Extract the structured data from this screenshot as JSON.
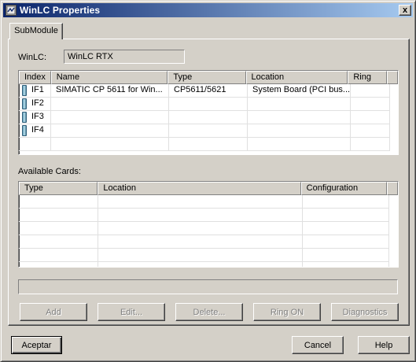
{
  "window": {
    "title": "WinLC Properties",
    "close_glyph": "x"
  },
  "tab": {
    "label": "SubModule"
  },
  "winlc": {
    "label": "WinLC:",
    "value": "WinLC RTX"
  },
  "submodules": {
    "columns": [
      "Index",
      "Name",
      "Type",
      "Location",
      "Ring"
    ],
    "rows": [
      [
        "IF1",
        "SIMATIC CP 5611 for Win...",
        "CP5611/5621",
        "System Board (PCI bus...",
        ""
      ],
      [
        "IF2",
        "",
        "",
        "",
        ""
      ],
      [
        "IF3",
        "",
        "",
        "",
        ""
      ],
      [
        "IF4",
        "",
        "",
        "",
        ""
      ]
    ]
  },
  "available_cards": {
    "label": "Available Cards:",
    "columns": [
      "Type",
      "Location",
      "Configuration"
    ]
  },
  "action_buttons": {
    "add": "Add",
    "edit": "Edit...",
    "delete": "Delete...",
    "ring_on": "Ring ON",
    "diagnostics": "Diagnostics"
  },
  "dialog_buttons": {
    "accept": "Aceptar",
    "cancel": "Cancel",
    "help": "Help"
  }
}
